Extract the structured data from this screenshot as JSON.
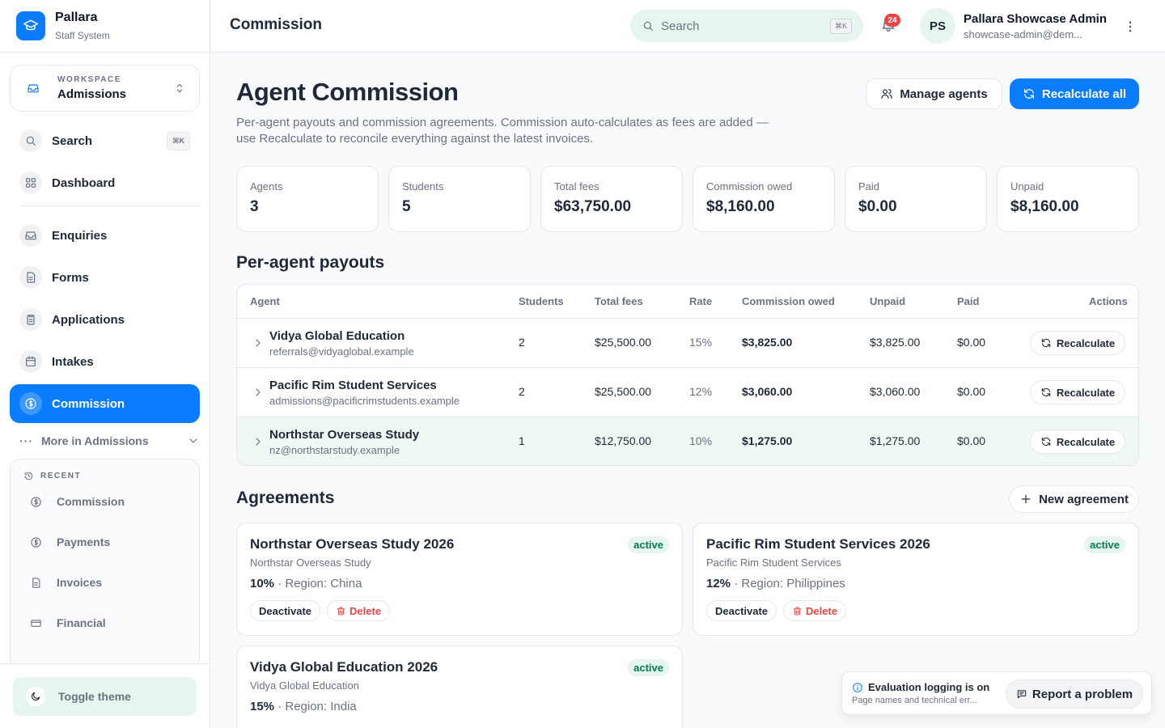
{
  "brand": {
    "name": "Pallara",
    "subtitle": "Staff System"
  },
  "workspace": {
    "label": "WORKSPACE",
    "name": "Admissions"
  },
  "nav": {
    "search": {
      "label": "Search",
      "shortcut": "⌘K"
    },
    "dashboard": "Dashboard",
    "enquiries": "Enquiries",
    "forms": "Forms",
    "applications": "Applications",
    "intakes": "Intakes",
    "commission": "Commission",
    "more": "More in Admissions"
  },
  "recent": {
    "label": "RECENT",
    "items": [
      "Commission",
      "Payments",
      "Invoices",
      "Financial"
    ]
  },
  "toggle_theme": "Toggle theme",
  "header": {
    "title": "Commission",
    "search_placeholder": "Search",
    "search_shortcut": "⌘K",
    "notifications": "24",
    "avatar_initials": "PS",
    "user_name": "Pallara Showcase Admin",
    "user_email": "showcase-admin@dem..."
  },
  "page": {
    "title": "Agent Commission",
    "description": "Per-agent payouts and commission agreements. Commission auto-calculates as fees are added — use Recalculate to reconcile everything against the latest invoices.",
    "manage_agents": "Manage agents",
    "recalculate_all": "Recalculate all"
  },
  "stats": [
    {
      "label": "Agents",
      "value": "3"
    },
    {
      "label": "Students",
      "value": "5"
    },
    {
      "label": "Total fees",
      "value": "$63,750.00"
    },
    {
      "label": "Commission owed",
      "value": "$8,160.00"
    },
    {
      "label": "Paid",
      "value": "$0.00"
    },
    {
      "label": "Unpaid",
      "value": "$8,160.00"
    }
  ],
  "payouts": {
    "title": "Per-agent payouts",
    "columns": [
      "Agent",
      "Students",
      "Total fees",
      "Rate",
      "Commission owed",
      "Unpaid",
      "Paid",
      "Actions"
    ],
    "action_label": "Recalculate",
    "rows": [
      {
        "name": "Vidya Global Education",
        "email": "referrals@vidyaglobal.example",
        "students": "2",
        "total_fees": "$25,500.00",
        "rate": "15%",
        "owed": "$3,825.00",
        "unpaid": "$3,825.00",
        "paid": "$0.00"
      },
      {
        "name": "Pacific Rim Student Services",
        "email": "admissions@pacificrimstudents.example",
        "students": "2",
        "total_fees": "$25,500.00",
        "rate": "12%",
        "owed": "$3,060.00",
        "unpaid": "$3,060.00",
        "paid": "$0.00"
      },
      {
        "name": "Northstar Overseas Study",
        "email": "nz@northstarstudy.example",
        "students": "1",
        "total_fees": "$12,750.00",
        "rate": "10%",
        "owed": "$1,275.00",
        "unpaid": "$1,275.00",
        "paid": "$0.00"
      }
    ]
  },
  "agreements": {
    "title": "Agreements",
    "new_label": "New agreement",
    "deactivate_label": "Deactivate",
    "delete_label": "Delete",
    "region_prefix": "· Region: ",
    "items": [
      {
        "title": "Northstar Overseas Study 2026",
        "agent": "Northstar Overseas Study",
        "rate": "10%",
        "region": "China",
        "status": "active"
      },
      {
        "title": "Pacific Rim Student Services 2026",
        "agent": "Pacific Rim Student Services",
        "rate": "12%",
        "region": "Philippines",
        "status": "active"
      },
      {
        "title": "Vidya Global Education 2026",
        "agent": "Vidya Global Education",
        "rate": "15%",
        "region": "India",
        "status": "active"
      }
    ]
  },
  "toast": {
    "title": "Evaluation logging is on",
    "subtitle": "Page names and technical err...",
    "button": "Report a problem"
  },
  "colors": {
    "accent": "#0a7cff",
    "active_status": "#047857",
    "danger": "#ef4444",
    "badge": "#ef4444"
  }
}
